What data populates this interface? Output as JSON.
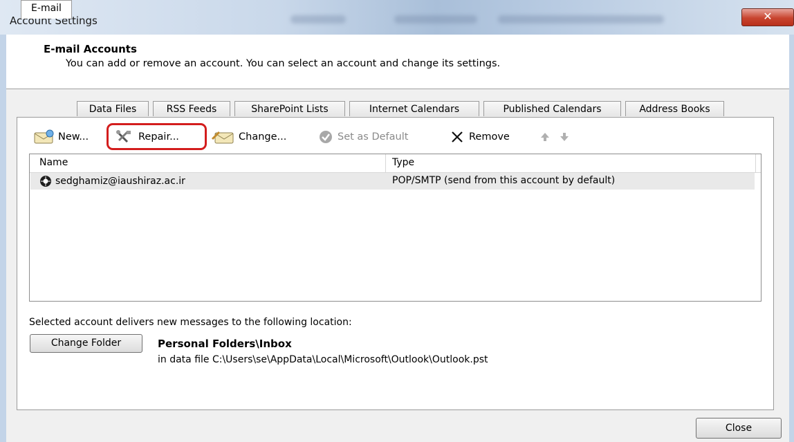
{
  "window": {
    "title": "Account Settings",
    "close_glyph": "✕"
  },
  "header": {
    "title": "E-mail Accounts",
    "subtitle": "You can add or remove an account. You can select an account and change its settings."
  },
  "tabs": [
    {
      "label": "E-mail",
      "active": true
    },
    {
      "label": "Data Files"
    },
    {
      "label": "RSS Feeds"
    },
    {
      "label": "SharePoint Lists"
    },
    {
      "label": "Internet Calendars"
    },
    {
      "label": "Published Calendars"
    },
    {
      "label": "Address Books"
    }
  ],
  "toolbar": {
    "new_label": "New...",
    "repair_label": "Repair...",
    "change_label": "Change...",
    "set_default_label": "Set as Default",
    "remove_label": "Remove"
  },
  "accounts": {
    "columns": [
      "Name",
      "Type"
    ],
    "rows": [
      {
        "name": "sedghamiz@iaushiraz.ac.ir",
        "type": "POP/SMTP (send from this account by default)"
      }
    ]
  },
  "delivery": {
    "text": "Selected account delivers new messages to the following location:",
    "change_folder_label": "Change Folder",
    "folder": "Personal Folders\\Inbox",
    "data_file": "in data file C:\\Users\\se\\AppData\\Local\\Microsoft\\Outlook\\Outlook.pst"
  },
  "footer": {
    "close_label": "Close"
  },
  "colors": {
    "highlight": "#d31d1d",
    "titlebar": "#c9d8ea",
    "close_button": "#c8442f"
  }
}
